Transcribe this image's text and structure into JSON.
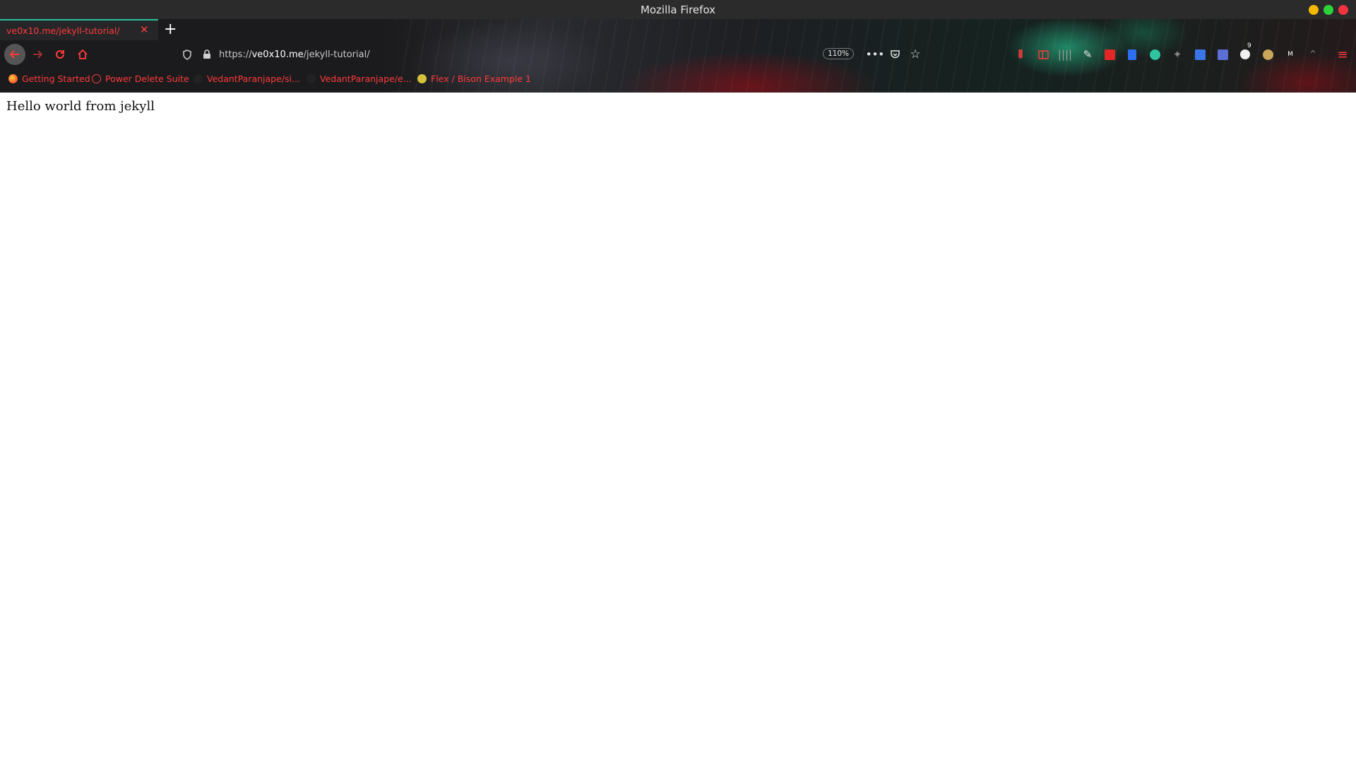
{
  "window": {
    "title": "Mozilla Firefox"
  },
  "tab": {
    "title": "ve0x10.me/jekyll-tutorial/",
    "close_icon": "close-icon",
    "new_tab": "+"
  },
  "nav": {
    "url_prefix": "https://",
    "url_domain": "ve0x10.me",
    "url_path": "/jekyll-tutorial/",
    "zoom": "110%"
  },
  "bookmarks": [
    {
      "label": "Getting Started",
      "icon": "firefox-icon"
    },
    {
      "label": "Power Delete Suite",
      "icon": "globe-icon"
    },
    {
      "label": "VedantParanjape/si...",
      "icon": "github-icon"
    },
    {
      "label": "VedantParanjape/e...",
      "icon": "github-icon"
    },
    {
      "label": "Flex / Bison Example 1",
      "icon": "bookmark-icon"
    }
  ],
  "extensions": {
    "badge_count": "9"
  },
  "page": {
    "text": "Hello world from jekyll"
  },
  "colors": {
    "accent": "#ff3b3b",
    "tab_indicator": "#25c29a"
  }
}
